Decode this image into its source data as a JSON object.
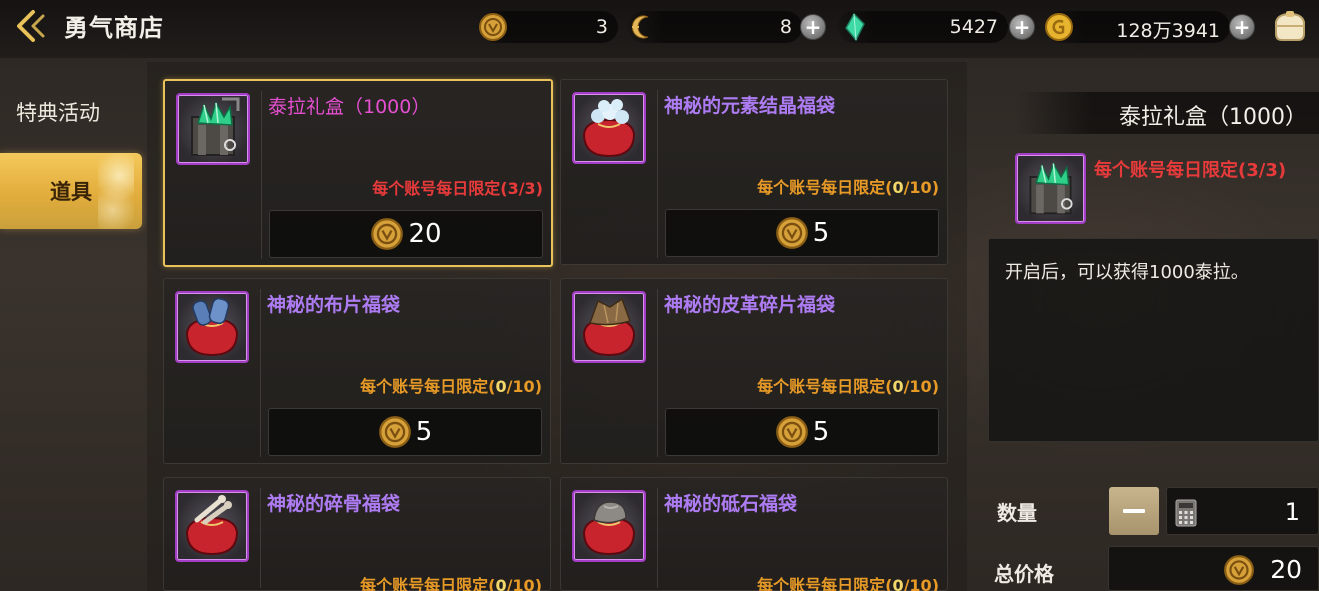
{
  "header": {
    "title": "勇气商店",
    "currencies": [
      {
        "name": "bravery-coin",
        "value": "3",
        "has_plus": false
      },
      {
        "name": "moon-token",
        "value": "8",
        "has_plus": true
      },
      {
        "name": "crystal",
        "value": "5427",
        "has_plus": true
      },
      {
        "name": "gold",
        "value": "128万3941",
        "has_plus": true
      }
    ],
    "plus_label": "+"
  },
  "nav": {
    "items": [
      {
        "label": "特典活动",
        "active": false
      },
      {
        "label": "道具",
        "active": true
      }
    ]
  },
  "products": [
    {
      "name": "泰拉礼盒（1000）",
      "limit_prefix": "每个账号每日限定(",
      "limit_count": "3",
      "limit_suffix": "/3)",
      "price": "20",
      "selected": true,
      "icon": "gem-box-icon"
    },
    {
      "name": "神秘的元素结晶福袋",
      "limit_prefix": "每个账号每日限定(",
      "limit_count": "0",
      "limit_suffix": "/10)",
      "price": "5",
      "selected": false,
      "icon": "crystal-bag-icon"
    },
    {
      "name": "神秘的布片福袋",
      "limit_prefix": "每个账号每日限定(",
      "limit_count": "0",
      "limit_suffix": "/10)",
      "price": "5",
      "selected": false,
      "icon": "cloth-bag-icon"
    },
    {
      "name": "神秘的皮革碎片福袋",
      "limit_prefix": "每个账号每日限定(",
      "limit_count": "0",
      "limit_suffix": "/10)",
      "price": "5",
      "selected": false,
      "icon": "leather-bag-icon"
    },
    {
      "name": "神秘的碎骨福袋",
      "limit_prefix": "每个账号每日限定(",
      "limit_count": "0",
      "limit_suffix": "/10)",
      "price": "",
      "selected": false,
      "icon": "bone-bag-icon"
    },
    {
      "name": "神秘的砥石福袋",
      "limit_prefix": "每个账号每日限定(",
      "limit_count": "0",
      "limit_suffix": "/10)",
      "price": "",
      "selected": false,
      "icon": "whetstone-bag-icon"
    }
  ],
  "detail": {
    "title": "泰拉礼盒（1000）",
    "limit": "每个账号每日限定(3/3)",
    "description": "开启后，可以获得1000泰拉。",
    "quantity_label": "数量",
    "quantity": "1",
    "total_label": "总价格",
    "total": "20"
  },
  "colors": {
    "accent_gold": "#e9c25a",
    "item_name_purple": "#ad7bf2",
    "item_name_selected_pink": "#e44fd0",
    "limit_orange": "#e89a26",
    "limit_red": "#e73a3a",
    "rarity_border": "#a23fc4"
  }
}
